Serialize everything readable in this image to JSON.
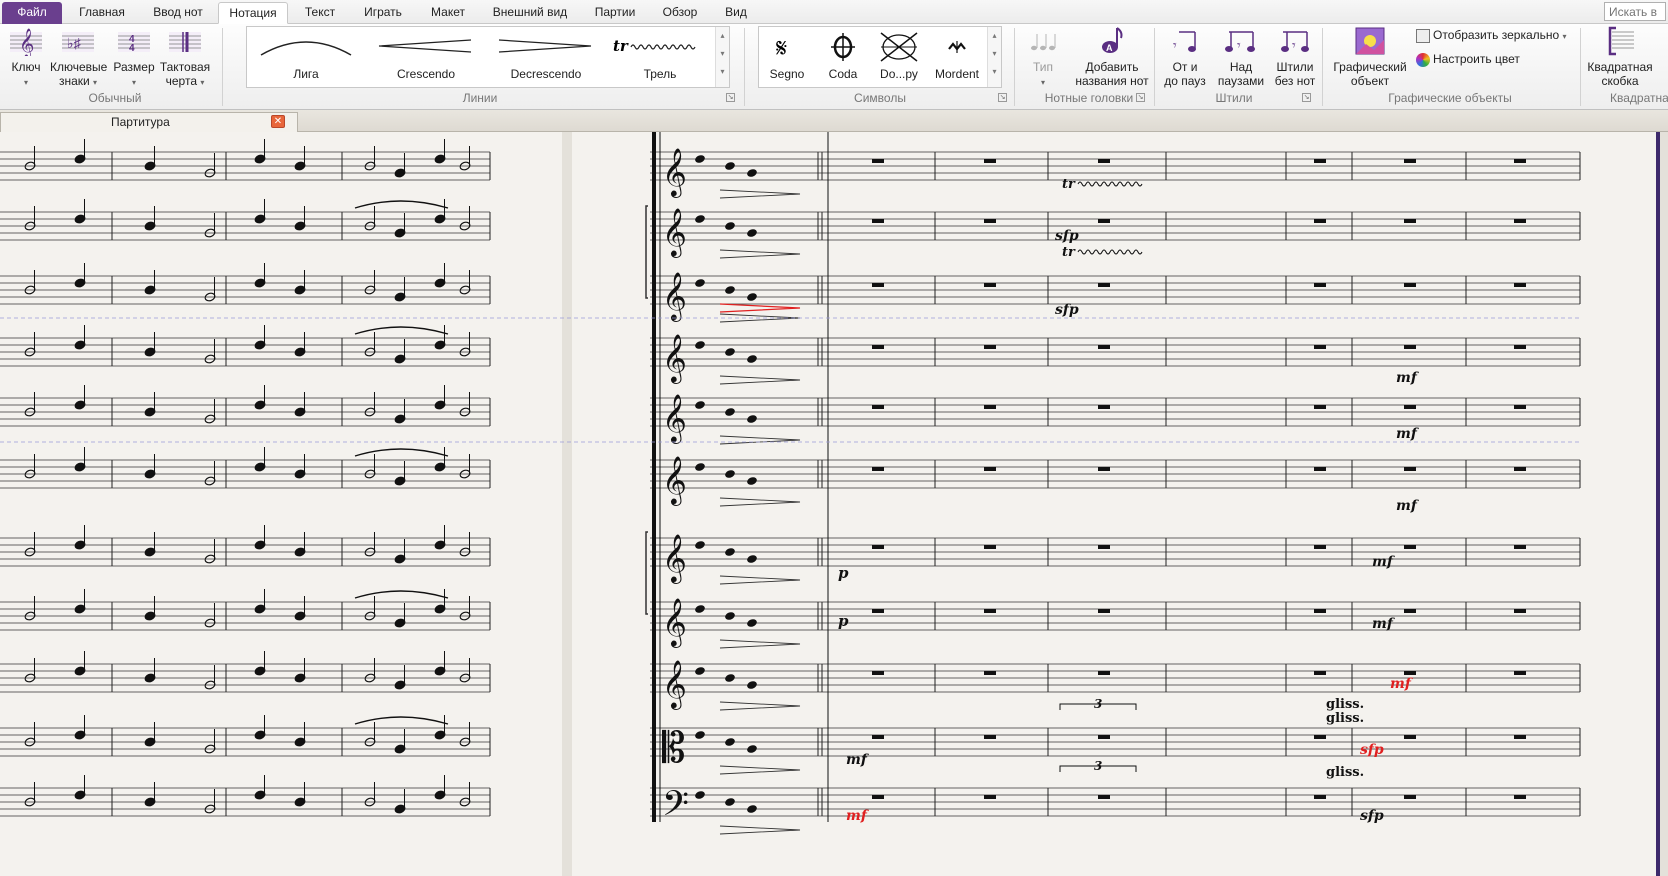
{
  "tabs": [
    {
      "label": "Файл"
    },
    {
      "label": "Главная"
    },
    {
      "label": "Ввод нот"
    },
    {
      "label": "Нотация"
    },
    {
      "label": "Текст"
    },
    {
      "label": "Играть"
    },
    {
      "label": "Макет"
    },
    {
      "label": "Внешний вид"
    },
    {
      "label": "Партии"
    },
    {
      "label": "Обзор"
    },
    {
      "label": "Вид"
    }
  ],
  "search": {
    "placeholder": "Искать в"
  },
  "ribbon": {
    "common": {
      "clef": "Ключ",
      "key_sig_1": "Ключевые",
      "key_sig_2": "знаки",
      "time_sig": "Размер",
      "barline_1": "Тактовая",
      "barline_2": "черта",
      "group": "Обычный"
    },
    "lines": {
      "slur": "Лига",
      "crescendo": "Crescendo",
      "decrescendo": "Decrescendo",
      "trill": "Трель",
      "group": "Линии"
    },
    "symbols": {
      "segno": "Segno",
      "coda": "Coda",
      "doppu": "Do...ру",
      "mordent": "Mordent",
      "group": "Символы"
    },
    "noteheads": {
      "type": "Тип",
      "add_names_1": "Добавить",
      "add_names_2": "названия нот",
      "group": "Нотные головки"
    },
    "stems": {
      "from_rests_1": "От и",
      "from_rests_2": "до пауз",
      "over_rests_1": "Над",
      "over_rests_2": "паузами",
      "no_notes_1": "Штили",
      "no_notes_2": "без нот",
      "group": "Штили"
    },
    "graphics": {
      "graphic_1": "Графический",
      "graphic_2": "объект",
      "mirror": "Отобразить зеркально",
      "color": "Настроить цвет",
      "group": "Графические объекты"
    },
    "brackets": {
      "square_1": "Квадратная",
      "square_2": "скобка",
      "group": "Квадратна"
    }
  },
  "document": {
    "tab_title": "Партитура"
  },
  "score": {
    "markings": {
      "trill": "tr",
      "sfp": "sfp",
      "mf": "mf",
      "p": "p",
      "gliss": "gliss.",
      "triplet": "3"
    }
  },
  "colors": {
    "file_tab": "#6a3f8e",
    "paper": "#f4f2ee",
    "desk": "#e4e1da",
    "selection_red": "#e02020",
    "system_bar": "#3d2a6b"
  }
}
